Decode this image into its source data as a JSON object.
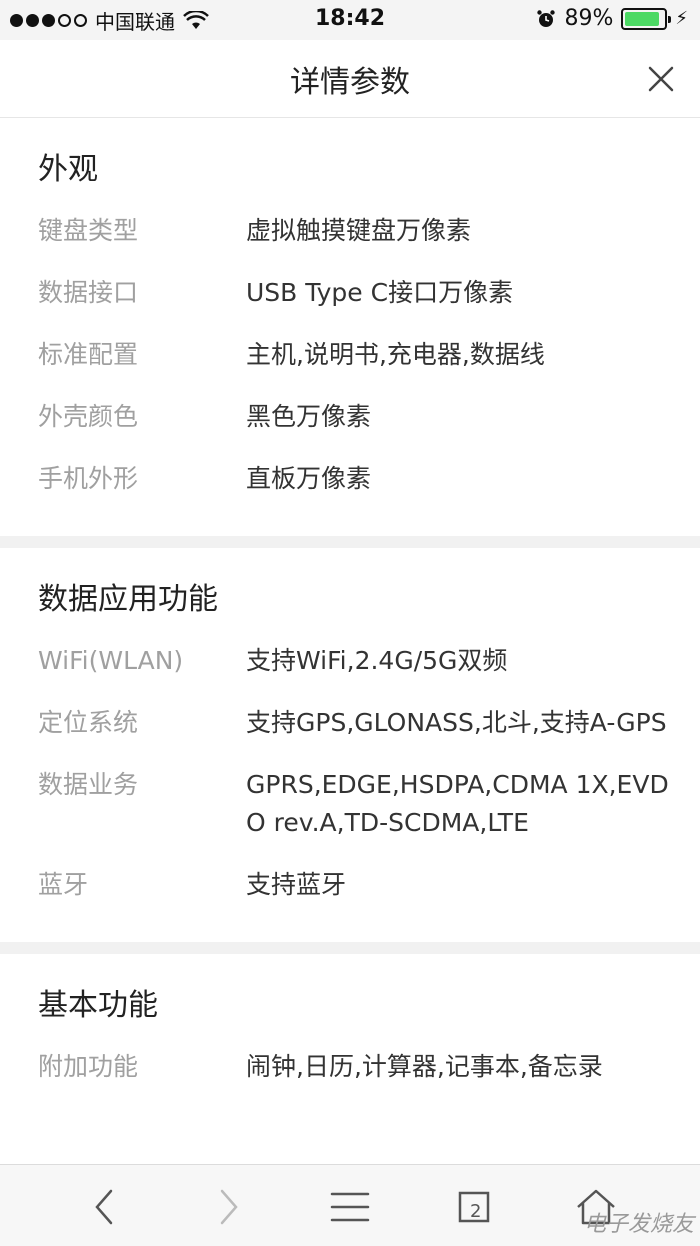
{
  "status_bar": {
    "carrier": "中国联通",
    "time": "18:42",
    "battery_percent_label": "89%",
    "battery_level": 0.89,
    "battery_color": "#4cd964"
  },
  "header": {
    "title": "详情参数"
  },
  "sections": [
    {
      "title": "外观",
      "rows": [
        {
          "label": "键盘类型",
          "value": "虚拟触摸键盘万像素"
        },
        {
          "label": "数据接口",
          "value": "USB Type C接口万像素"
        },
        {
          "label": "标准配置",
          "value": "主机,说明书,充电器,数据线"
        },
        {
          "label": "外壳颜色",
          "value": "黑色万像素"
        },
        {
          "label": "手机外形",
          "value": "直板万像素"
        }
      ]
    },
    {
      "title": "数据应用功能",
      "rows": [
        {
          "label": "WiFi(WLAN)",
          "value": "支持WiFi,2.4G/5G双频"
        },
        {
          "label": "定位系统",
          "value": "支持GPS,GLONASS,北斗,支持A-GPS"
        },
        {
          "label": "数据业务",
          "value": "GPRS,EDGE,HSDPA,CDMA 1X,EVDO rev.A,TD-SCDMA,LTE"
        },
        {
          "label": "蓝牙",
          "value": "支持蓝牙"
        }
      ]
    },
    {
      "title": "基本功能",
      "rows": [
        {
          "label": "附加功能",
          "value": "闹钟,日历,计算器,记事本,备忘录"
        }
      ]
    }
  ],
  "toolbar": {
    "tab_count": "2",
    "icons": [
      "back-icon",
      "forward-icon",
      "menu-icon",
      "tabs-icon",
      "home-icon"
    ]
  },
  "watermark": "电子发烧友"
}
